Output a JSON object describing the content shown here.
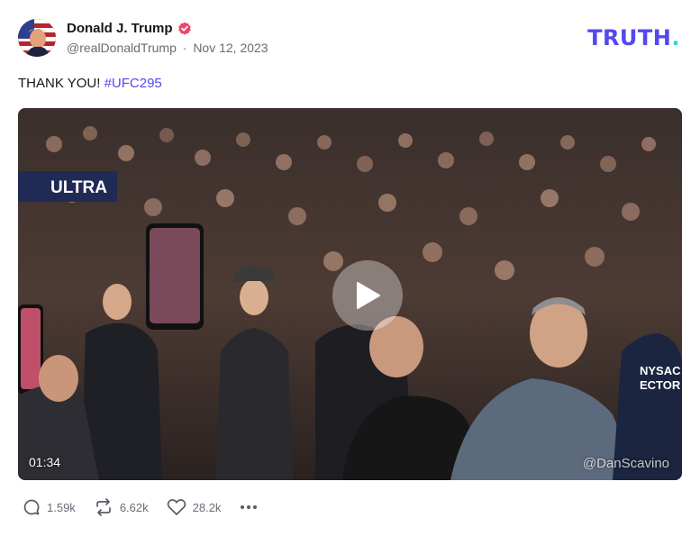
{
  "post": {
    "author_name": "Donald J. Trump",
    "handle": "@realDonaldTrump",
    "separator": "·",
    "date": "Nov 12, 2023",
    "text": "THANK YOU! ",
    "hashtag": "#UFC295"
  },
  "brand": {
    "logo_text": "TRUTH",
    "logo_dot": ".",
    "primary_color": "#5448ee",
    "accent_color": "#3bd0c4"
  },
  "video": {
    "duration": "01:34",
    "watermark": "@DanScavino",
    "banner_text": "ULTRA",
    "jacket_text_1": "NYSAC",
    "jacket_text_2": "ECTOR"
  },
  "actions": {
    "replies": "1.59k",
    "retruths": "6.62k",
    "likes": "28.2k",
    "icons": [
      "reply-icon",
      "retruth-icon",
      "like-icon",
      "more-icon"
    ]
  }
}
